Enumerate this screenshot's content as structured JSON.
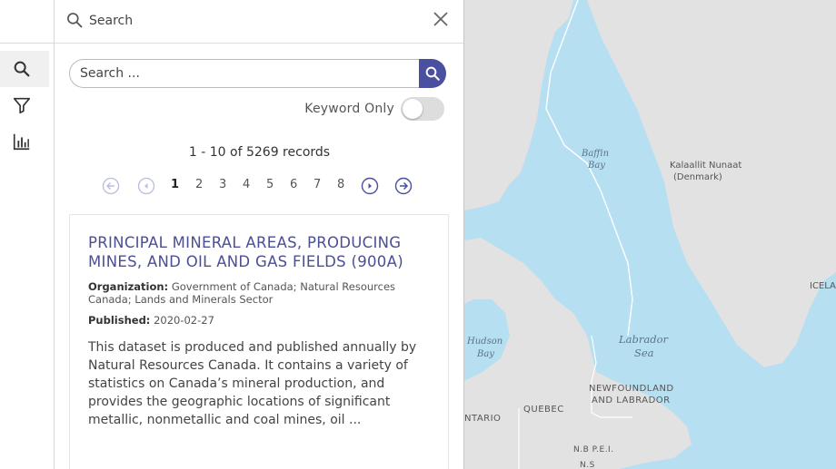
{
  "header": {
    "search_label": "Search"
  },
  "search": {
    "placeholder": "Search ..."
  },
  "keyword": {
    "label": "Keyword Only",
    "enabled": false
  },
  "results": {
    "summary": "1 - 10 of 5269 records",
    "pages": [
      "1",
      "2",
      "3",
      "4",
      "5",
      "6",
      "7",
      "8"
    ],
    "current_page": "1"
  },
  "card": {
    "title": "PRINCIPAL MINERAL AREAS, PRODUCING MINES, AND OIL AND GAS FIELDS (900A)",
    "organization_label": "Organization:",
    "organization_value": "Government of Canada; Natural Resources Canada; Lands and Minerals Sector",
    "published_label": "Published:",
    "published_value": "2020-02-27",
    "description": "This dataset is produced and published annually by Natural Resources Canada. It contains a variety of statistics on Canada’s mineral production, and provides the geographic locations of significant metallic, nonmetallic and coal mines, oil ..."
  },
  "map": {
    "labels": {
      "baffin_1": "Baffin",
      "baffin_2": "Bay",
      "greenland_1": "Kalaallit Nunaat",
      "greenland_2": "(Denmark)",
      "iceland": "ICELA",
      "labrador_sea_1": "Labrador",
      "labrador_sea_2": "Sea",
      "hudson_1": "Hudson",
      "hudson_2": "Bay",
      "nfl_1": "NEWFOUNDLAND",
      "nfl_2": "AND LABRADOR",
      "quebec": "QUEBEC",
      "ontario": "NTARIO",
      "nb_pei": "N.B  P.E.I.",
      "ns": "N.S"
    },
    "colors": {
      "water": "#b7dff2",
      "land": "#e2e2e2",
      "accent": "#4a4f9f"
    }
  },
  "icons": {
    "rail": [
      "search-icon",
      "filter-icon",
      "bar-chart-icon"
    ]
  }
}
